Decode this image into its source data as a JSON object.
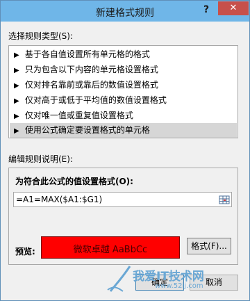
{
  "dialog": {
    "title": "新建格式规则",
    "help": "?",
    "close": "✕"
  },
  "rule_type": {
    "label": "选择规则类型(S):",
    "items": [
      {
        "label": "基于各自值设置所有单元格的格式",
        "selected": false
      },
      {
        "label": "只为包含以下内容的单元格设置格式",
        "selected": false
      },
      {
        "label": "仅对排名靠前或靠后的数值设置格式",
        "selected": false
      },
      {
        "label": "仅对高于或低于平均值的数值设置格式",
        "selected": false
      },
      {
        "label": "仅对唯一值或重复值设置格式",
        "selected": false
      },
      {
        "label": "使用公式确定要设置格式的单元格",
        "selected": true
      }
    ],
    "arrow": "▶"
  },
  "edit": {
    "label": "编辑规则说明(E):",
    "formula_caption": "为符合此公式的值设置格式(O):",
    "formula_value": "=A1=MAX($A1:$G1)",
    "preview_label": "预览:",
    "preview_text": "微软卓越  AaBbCc",
    "preview_color": "#ff0000",
    "format_button": "格式(F)..."
  },
  "footer": {
    "ok": "确定",
    "cancel": "取消"
  },
  "watermark": {
    "text": "我爱IT技术网",
    "url": "www.52ij.com"
  }
}
